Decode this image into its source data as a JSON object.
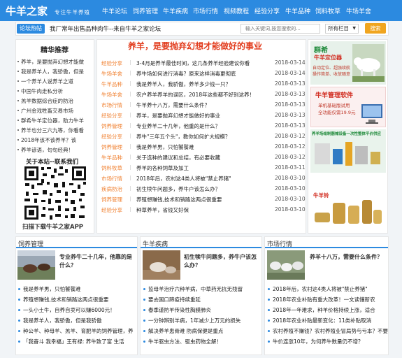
{
  "site": {
    "logo": "牛羊之家",
    "tagline": "专注牛羊养殖",
    "nav": [
      "牛羊论坛",
      "饲养管理",
      "牛羊疾病",
      "市场行情",
      "视频教程",
      "经验分享",
      "牛羊品种",
      "饲料牧草",
      "牛场羊舍"
    ]
  },
  "notice": {
    "tag": "论坛热帖",
    "text": "我厂常年出售品种肉牛--来自牛羊之家论坛"
  },
  "search": {
    "placeholder": "输入关键词,按您搜索的...",
    "select": "所有栏目",
    "button": "搜索"
  },
  "recommend": {
    "title": "精华推荐",
    "items": [
      "养羊，是要抛弃幻想才能做",
      "我是养羊人，我骄傲，但是",
      "一个养羊人说养羊之道",
      "中国牛肉走私分析",
      "羔羊数据综合症的防治",
      "广州金戏牲畜交易市场",
      "群希牛羊定位器，助力牛羊",
      "养羊也分三六九等，你看看",
      "2018年该不该养羊？该",
      "养羊谚语，句句经典！"
    ]
  },
  "mobile": {
    "title": "关于本站--联系我们",
    "caption": "扫描下载牛羊之家APP"
  },
  "articles": {
    "headline": "养羊，是要抛弃幻想才能做好的事业",
    "items": [
      {
        "cat": "经验分享",
        "title": "3-4月是养羊最佳时间，这几条养羊经验建议你看",
        "date": "2018-03-14"
      },
      {
        "cat": "牛场羊舍",
        "title": "养牛场如何进行消毒？原来这样消毒更彻底",
        "date": "2018-03-14"
      },
      {
        "cat": "牛羊品种",
        "title": "我是养羊人，我骄傲，养羊多少钱一只？",
        "date": "2018-03-13"
      },
      {
        "cat": "牛场羊舍",
        "title": "农户养羊养羊的误区，2018年这些都不好别这养！",
        "date": "2018-03-13"
      },
      {
        "cat": "市场行情",
        "title": "牛羊养十八万，需要什么条件？",
        "date": "2018-03-13"
      },
      {
        "cat": "经验分享",
        "title": "养羊，是要抛弃幻想才能做好的事业",
        "date": "2018-03-13"
      },
      {
        "cat": "饲养管理",
        "title": "专业养羊二十几年，他重的是什么？",
        "date": "2018-03-13"
      },
      {
        "cat": "经验分享",
        "title": "养牛\"三年五个头\"，教你如何扩大规模？",
        "date": "2018-03-12"
      },
      {
        "cat": "饲养管理",
        "title": "我是养羊男，只怕饕餮难",
        "date": "2018-03-12"
      },
      {
        "cat": "牛羊品种",
        "title": "关于选种的建议和总结，有必要收藏",
        "date": "2018-03-12"
      },
      {
        "cat": "饲料牧草",
        "title": "养羊的各种饲草及加工",
        "date": "2018-03-11"
      },
      {
        "cat": "市场行情",
        "title": "2018年后，农村这4类人将被\"禁止养猪\"",
        "date": "2018-03-10"
      },
      {
        "cat": "疾病防治",
        "title": "初生犊牛问题多，养牛户该怎么办？",
        "date": "2018-03-10"
      },
      {
        "cat": "饲养管理",
        "title": "养殖想赚钱,技术和销路这两点很重要",
        "date": "2018-03-10"
      },
      {
        "cat": "经验分享",
        "title": "种草养羊，省钱又好保",
        "date": "2018-03-10"
      }
    ]
  },
  "ads": {
    "ad1_title": "群希",
    "ad1_sub": "牛羊定位器",
    "ad1_lines": [
      "自动定位、超强续航",
      "操作简单、收放随意"
    ],
    "ad2_title": "牛羊管理软件",
    "ad2_lines": [
      "单机基础版试用",
      "全功能仅需19.9元"
    ],
    "ad3_text": "养羊场绘制器械设备一次性整体平价供应",
    "ad4_title": "牛羊铃"
  },
  "sections": {
    "feed": {
      "title": "饲养管理",
      "feature": "专业养牛二十几年，他靠的是什么？",
      "items": [
        "我是养羊男，只怕饕餮难",
        "养殖想赚钱,技术和销路这两点很重要",
        "一头小土牛，自养自卖可以赚6000元！",
        "我是养羊人，我骄傲，但是我骄傲",
        "种公羊、种母羊、羔羊、育肥羊的饲养管理，养",
        "「我奋斗 我幸福」王有禄: 养牛致了富 生活"
      ]
    },
    "disease": {
      "title": "牛羊疾病",
      "feature": "初生犊牛问题多，养牛户该怎么办？",
      "items": [
        "监母羊治疗六种羊病，中草药无抗无残留",
        "要去国口蹄疫持续重延",
        "春季谨防羊传染性胸膜肺炎",
        "一分钟辨别羊病，1年减少上万元的损失",
        "解决养羊患骨难 防病保健是重点",
        "牛羊驱虫方法、驱虫药物全解！"
      ]
    },
    "market": {
      "title": "市场行情",
      "feature": "养羊十八万，需要什么条件？",
      "items": [
        "2018年后，农村这4类人将被\"禁止养猪\"",
        "2018年农业补贴有重大改革！一文读懂新农",
        "2018年一年难求，种羊价格持续上涨，适合",
        "2018年农业补贴最新变化：11类补贴取消",
        "农村养殖不赚钱？农村养殖业冒局势与亏本？不要担",
        "牛价连涨10年，为何养牛数量仍不增？"
      ]
    }
  },
  "colors": {
    "brand": "#2c8ae0",
    "accent": "#e23c1d",
    "category": "#f08030",
    "button": "#f0a51f"
  }
}
